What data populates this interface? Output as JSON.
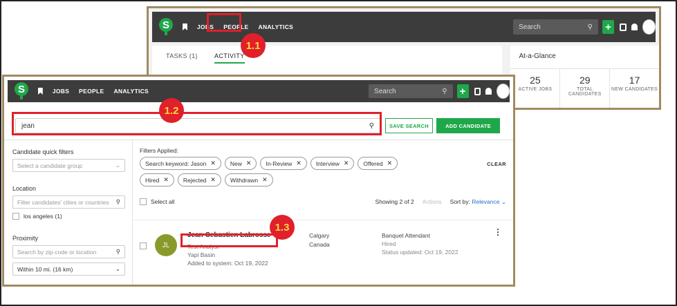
{
  "back_window": {
    "nav": {
      "jobs": "JOBS",
      "people": "PEOPLE",
      "analytics": "ANALYTICS"
    },
    "search_placeholder": "Search",
    "tabs": {
      "tasks": "TASKS (1)",
      "activity": "ACTIVITY"
    },
    "glance": {
      "title": "At-a-Glance",
      "stats": [
        {
          "num": "25",
          "label": "ACTIVE JOBS"
        },
        {
          "num": "29",
          "label": "TOTAL CANDIDATES"
        },
        {
          "num": "17",
          "label": "NEW CANDIDATES"
        }
      ]
    }
  },
  "front_window": {
    "nav": {
      "jobs": "JOBS",
      "people": "PEOPLE",
      "analytics": "ANALYTICS"
    },
    "search_placeholder": "Search",
    "search_value": "jean",
    "save_search": "SAVE SEARCH",
    "add_candidate": "ADD CANDIDATE",
    "sidebar": {
      "quick_filters_label": "Candidate quick filters",
      "quick_filters_placeholder": "Select a candidate group",
      "location_label": "Location",
      "location_placeholder": "Filter candidates' cities or countries",
      "location_option": "los angeles (1)",
      "proximity_label": "Proximity",
      "proximity_placeholder": "Search by zip-code or location",
      "proximity_value": "Within 10 mi. (16 km)"
    },
    "filters_label": "Filters Applied:",
    "chips": [
      "Search keyword: Jason",
      "New",
      "In-Review",
      "Interview",
      "Offered",
      "Hired",
      "Rejected",
      "Withdrawn"
    ],
    "clear": "CLEAR",
    "select_all": "Select all",
    "showing": "Showing 2 of 2",
    "actions": "Actions",
    "sort_by": "Sort by:",
    "sort_value": "Relevance",
    "candidate": {
      "initials": "JL",
      "name": "Jean-Sebastien Labrosse",
      "title": "Test Analyst",
      "company": "Yapi Basin",
      "added": "Added to system: Oct 19, 2022",
      "city": "Calgary",
      "country": "Canada",
      "job": "Banquet Attendant",
      "status": "Hired",
      "status_updated": "Status updated: Oct 19, 2022"
    }
  },
  "annotations": {
    "a1": "1.1",
    "a2": "1.2",
    "a3": "1.3"
  },
  "colors": {
    "accent": "#1fa84a",
    "highlight": "#e0202a",
    "frame": "#a08a62"
  }
}
